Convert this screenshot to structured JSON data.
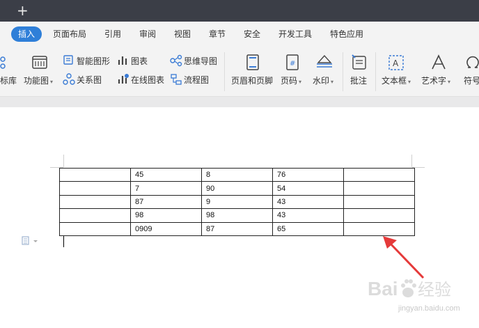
{
  "titlebar": {
    "new_tab_icon": "plus-icon"
  },
  "menu": {
    "tabs": [
      {
        "label": "插入",
        "active": true
      },
      {
        "label": "页面布局"
      },
      {
        "label": "引用"
      },
      {
        "label": "审阅"
      },
      {
        "label": "视图"
      },
      {
        "label": "章节"
      },
      {
        "label": "安全"
      },
      {
        "label": "开发工具"
      },
      {
        "label": "特色应用"
      }
    ],
    "active_color": "#2f7fd8"
  },
  "ribbon": {
    "partial_library": "标库",
    "function_chart": "功能图",
    "smart_shape": "智能图形",
    "chart": "图表",
    "mind_map": "思维导图",
    "relation_chart": "关系图",
    "online_chart": "在线图表",
    "flow_chart": "流程图",
    "header_footer": "页眉和页脚",
    "page_number": "页码",
    "watermark": "水印",
    "comment": "批注",
    "text_box": "文本框",
    "word_art": "艺术字",
    "symbol": "符号"
  },
  "table": {
    "rows": [
      [
        "",
        "45",
        "8",
        "76",
        ""
      ],
      [
        "",
        "7",
        "90",
        "54",
        ""
      ],
      [
        "",
        "87",
        "9",
        "43",
        ""
      ],
      [
        "",
        "98",
        "98",
        "43",
        ""
      ],
      [
        "",
        "0909",
        "87",
        "65",
        ""
      ]
    ]
  },
  "watermark_image": {
    "brand": "Baidu经验",
    "url_text": "jingyan.baidu.com"
  },
  "colors": {
    "titlebar": "#3b3e47",
    "ribbon_bg": "#f3f3f3",
    "arrow": "#e53a3a"
  }
}
